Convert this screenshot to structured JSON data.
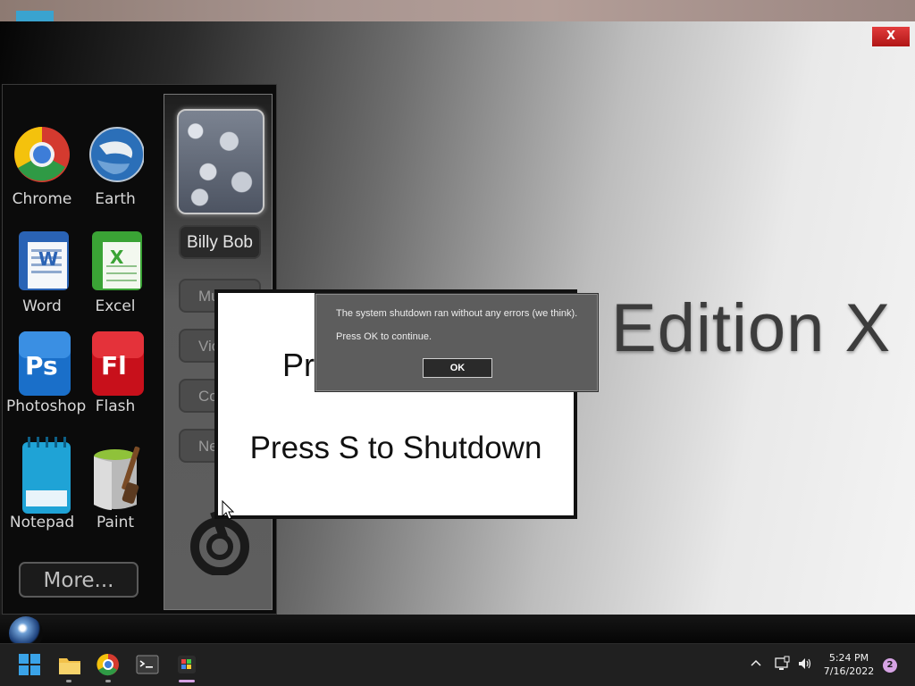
{
  "close_button": {
    "label": "X"
  },
  "brand": {
    "edition_text": "Edition X"
  },
  "start_menu": {
    "apps": [
      {
        "label": "Chrome",
        "icon": "chrome-icon"
      },
      {
        "label": "Earth",
        "icon": "google-earth-icon"
      },
      {
        "label": "Word",
        "icon": "word-icon"
      },
      {
        "label": "Excel",
        "icon": "excel-icon"
      },
      {
        "label": "Photoshop",
        "icon": "photoshop-icon",
        "icon_text": "Ps"
      },
      {
        "label": "Flash",
        "icon": "flash-icon",
        "icon_text": "Fl"
      },
      {
        "label": "Notepad",
        "icon": "notepad-icon"
      },
      {
        "label": "Paint",
        "icon": "paint-bucket-icon"
      }
    ],
    "more_label": "More...",
    "user_name": "Billy Bob",
    "right_items": [
      "Mu",
      "Vic",
      "Com",
      "Net"
    ]
  },
  "white_dialog": {
    "partial_text": "Pre",
    "shutdown_text": "Press S to Shutdown"
  },
  "message_box": {
    "line1": "The system shutdown ran without any errors (we think).",
    "line2": "Press OK to continue.",
    "ok_label": "OK"
  },
  "taskbar": {
    "time": "5:24 PM",
    "date": "7/16/2022",
    "notification_count": "2"
  }
}
